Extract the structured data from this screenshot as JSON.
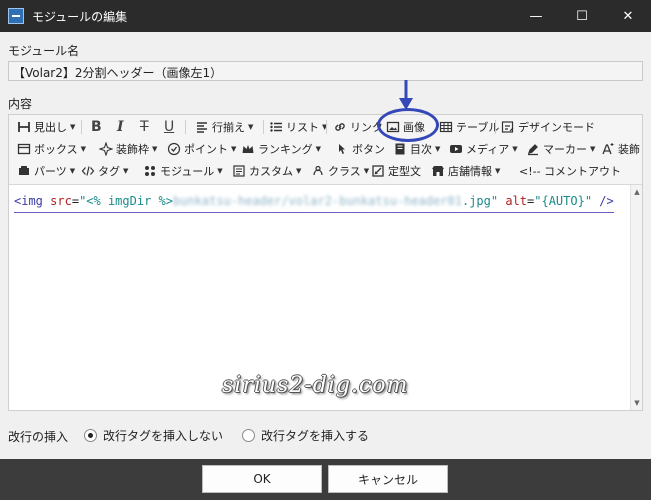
{
  "window": {
    "title": "モジュールの編集",
    "minimize_glyph": "—",
    "maximize_glyph": "☐",
    "close_glyph": "✕"
  },
  "module_name": {
    "label": "モジュール名",
    "value": "【Volar2】2分割ヘッダー（画像左1）"
  },
  "content": {
    "label": "内容"
  },
  "toolbar": {
    "row1": {
      "heading": "見出し",
      "bold": "B",
      "italic": "I",
      "strike": "T",
      "underline": "U",
      "align": "行揃え",
      "list": "リスト",
      "link": "リンク",
      "image": "画像",
      "table": "テーブル",
      "design_mode": "デザインモード"
    },
    "row2": {
      "box": "ボックス",
      "decoration": "装飾枠",
      "point": "ポイント",
      "ranking": "ランキング",
      "button": "ボタン",
      "toc": "目次",
      "media": "メディア",
      "marker": "マーカー",
      "decoration2": "装飾"
    },
    "row3": {
      "parts": "パーツ",
      "tag": "タグ",
      "module": "モジュール",
      "custom": "カスタム",
      "class": "クラス",
      "template": "定型文",
      "store_info": "店舗情報",
      "comment_out": "<!-- コメントアウト"
    }
  },
  "code": {
    "open": "<img",
    "src_attr": "src",
    "eq": "=",
    "src_prefix": "\"<% imgDir %>",
    "src_path": "bunkatsu-header/volar2-bunkatsu-header01",
    "src_ext": ".jpg\"",
    "alt_attr": "alt",
    "alt_value": "\"{AUTO}\"",
    "close": "/>"
  },
  "watermark": "sirius2-dig.com",
  "linebreak": {
    "label": "改行の挿入",
    "option_no": "改行タグを挿入しない",
    "option_yes": "改行タグを挿入する",
    "selected": "option_no"
  },
  "buttons": {
    "ok": "OK",
    "cancel": "キャンセル"
  },
  "colors": {
    "titlebar": "#2b2b2b",
    "footer": "#3c3c3c",
    "annotation": "#3548b8",
    "code_tag": "#3a3aa8",
    "code_attr": "#b22222",
    "code_string": "#1a8a8a"
  },
  "icons": {
    "app": "app-icon",
    "heading": "heading-icon",
    "align": "align-left-icon",
    "list": "list-icon",
    "link": "link-icon",
    "image": "image-icon",
    "table": "table-icon",
    "design_mode": "design-mode-icon",
    "box": "box-icon",
    "decoration": "decoration-frame-icon",
    "point": "check-circle-icon",
    "ranking": "crown-icon",
    "button": "pointer-icon",
    "toc": "book-icon",
    "media": "play-icon",
    "marker": "marker-icon",
    "decoration2": "text-effect-icon",
    "parts": "parts-icon",
    "tag": "code-tag-icon",
    "module": "module-icon",
    "custom": "custom-icon",
    "class": "class-icon",
    "template": "template-icon",
    "store_info": "store-icon"
  }
}
